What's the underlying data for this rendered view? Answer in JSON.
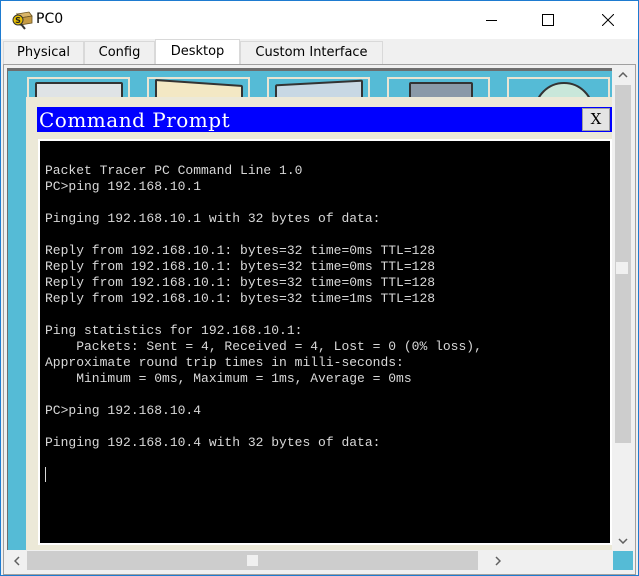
{
  "window": {
    "title": "PC0",
    "app_icon": "packet-tracer-pc-icon",
    "controls": {
      "minimize_icon": "minimize-icon",
      "maximize_icon": "maximize-icon",
      "close_icon": "close-icon"
    }
  },
  "tabs": [
    {
      "label": "Physical",
      "active": false
    },
    {
      "label": "Config",
      "active": false
    },
    {
      "label": "Desktop",
      "active": true
    },
    {
      "label": "Custom Interface",
      "active": false
    }
  ],
  "command_prompt": {
    "title": "Command Prompt",
    "close_label": "X",
    "lines": [
      "Packet Tracer PC Command Line 1.0",
      "PC>ping 192.168.10.1",
      "",
      "Pinging 192.168.10.1 with 32 bytes of data:",
      "",
      "Reply from 192.168.10.1: bytes=32 time=0ms TTL=128",
      "Reply from 192.168.10.1: bytes=32 time=0ms TTL=128",
      "Reply from 192.168.10.1: bytes=32 time=0ms TTL=128",
      "Reply from 192.168.10.1: bytes=32 time=1ms TTL=128",
      "",
      "Ping statistics for 192.168.10.1:",
      "    Packets: Sent = 4, Received = 4, Lost = 0 (0% loss),",
      "Approximate round trip times in milli-seconds:",
      "    Minimum = 0ms, Maximum = 1ms, Average = 0ms",
      "",
      "PC>ping 192.168.10.4",
      "",
      "Pinging 192.168.10.4 with 32 bytes of data:",
      ""
    ]
  },
  "colors": {
    "cmd_title_bg": "#0000ff",
    "desktop_bg": "#55bbd6",
    "terminal_bg": "#000000",
    "terminal_fg": "#d8d8d8"
  }
}
